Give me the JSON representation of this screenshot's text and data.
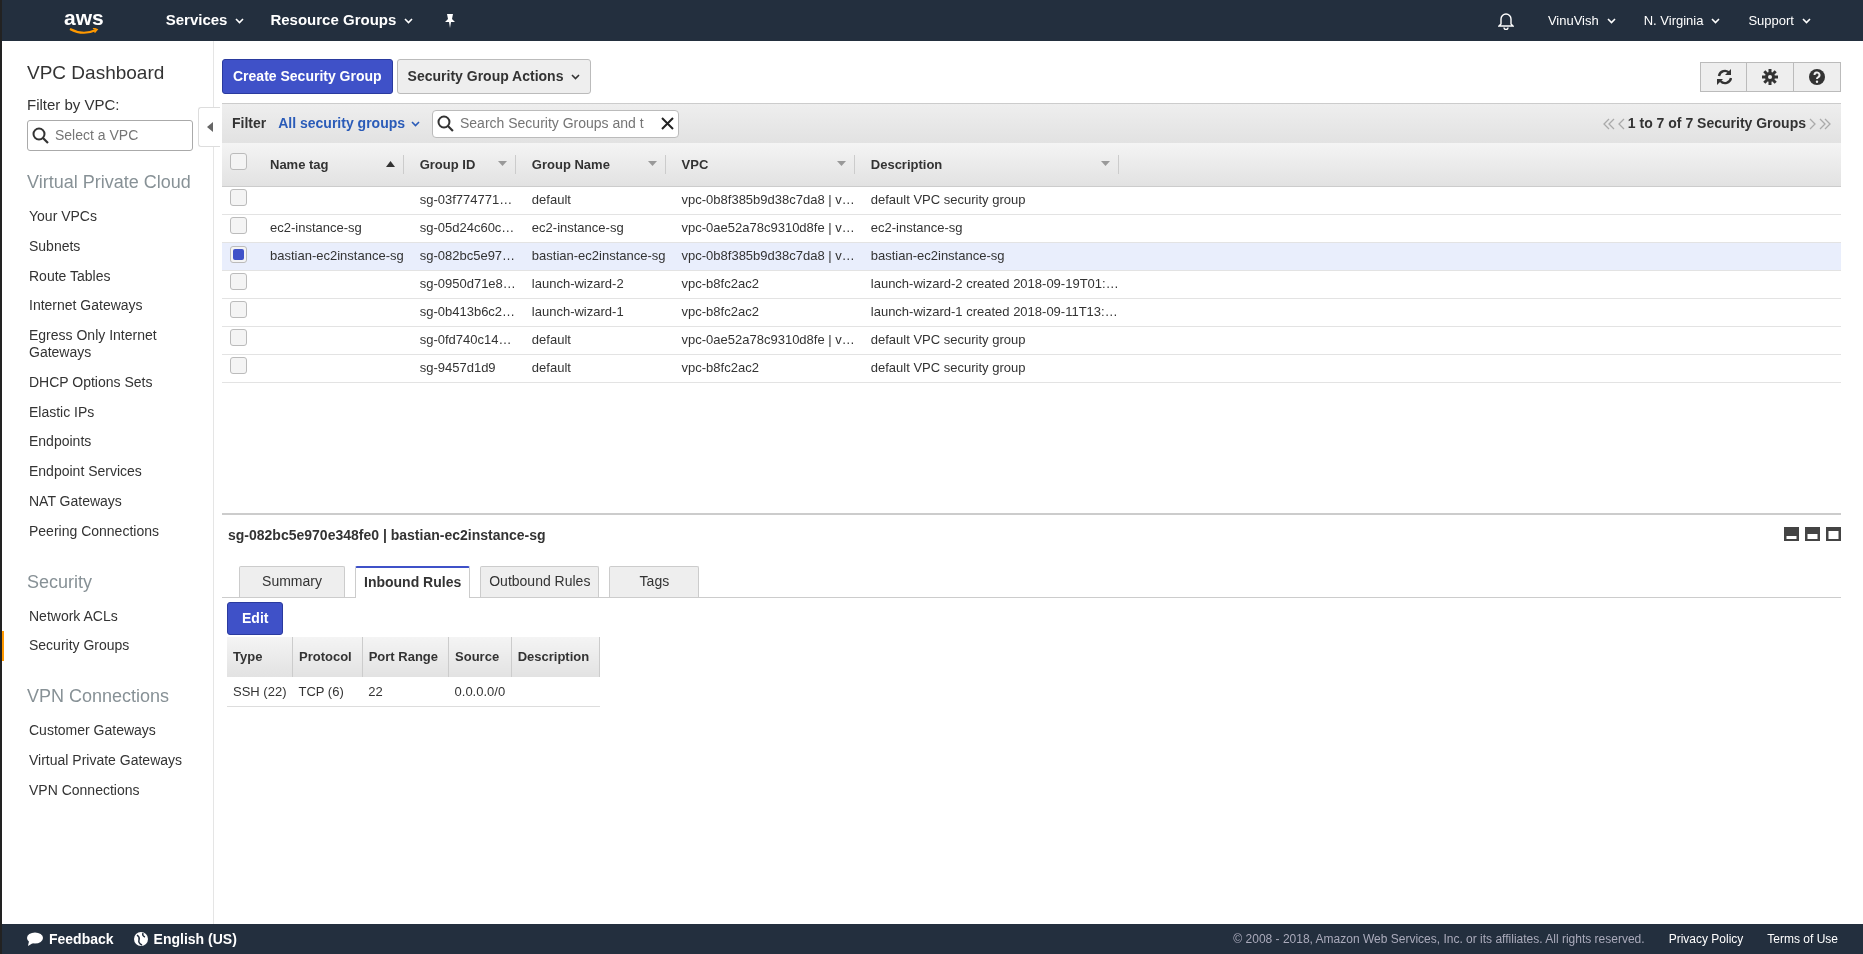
{
  "topbar": {
    "logo": "aws",
    "menus": [
      {
        "label": "Services"
      },
      {
        "label": "Resource Groups"
      }
    ],
    "right_menus": [
      {
        "label": "VinuVish"
      },
      {
        "label": "N. Virginia"
      },
      {
        "label": "Support"
      }
    ]
  },
  "sidebar": {
    "title": "VPC Dashboard",
    "filter_label": "Filter by VPC:",
    "filter_placeholder": "Select a VPC",
    "sections": [
      {
        "heading": "Virtual Private Cloud",
        "items": [
          {
            "label": "Your VPCs",
            "selected": false
          },
          {
            "label": "Subnets",
            "selected": false
          },
          {
            "label": "Route Tables",
            "selected": false
          },
          {
            "label": "Internet Gateways",
            "selected": false
          },
          {
            "label": "Egress Only Internet Gateways",
            "selected": false
          },
          {
            "label": "DHCP Options Sets",
            "selected": false
          },
          {
            "label": "Elastic IPs",
            "selected": false
          },
          {
            "label": "Endpoints",
            "selected": false
          },
          {
            "label": "Endpoint Services",
            "selected": false
          },
          {
            "label": "NAT Gateways",
            "selected": false
          },
          {
            "label": "Peering Connections",
            "selected": false
          }
        ]
      },
      {
        "heading": "Security",
        "items": [
          {
            "label": "Network ACLs",
            "selected": false
          },
          {
            "label": "Security Groups",
            "selected": true
          }
        ]
      },
      {
        "heading": "VPN Connections",
        "items": [
          {
            "label": "Customer Gateways",
            "selected": false
          },
          {
            "label": "Virtual Private Gateways",
            "selected": false
          },
          {
            "label": "VPN Connections",
            "selected": false
          }
        ]
      }
    ]
  },
  "toolbar": {
    "create_button": "Create Security Group",
    "actions_button": "Security Group Actions"
  },
  "filter_bar": {
    "label": "Filter",
    "dropdown": "All security groups",
    "search_placeholder": "Search Security Groups and t",
    "pagination": "1 to 7 of 7 Security Groups"
  },
  "table": {
    "select_all_checked": false,
    "columns": [
      {
        "label": "Name tag",
        "sorted": true
      },
      {
        "label": "Group ID",
        "sorted": false
      },
      {
        "label": "Group Name",
        "sorted": false
      },
      {
        "label": "VPC",
        "sorted": false
      },
      {
        "label": "Description",
        "sorted": false
      }
    ],
    "rows": [
      {
        "selected": false,
        "cells": [
          "",
          "sg-03f774771…",
          "default",
          "vpc-0b8f385b9d38c7da8 | v…",
          "default VPC security group"
        ]
      },
      {
        "selected": false,
        "cells": [
          "ec2-instance-sg",
          "sg-05d24c60c…",
          "ec2-instance-sg",
          "vpc-0ae52a78c9310d8fe | v…",
          "ec2-instance-sg"
        ]
      },
      {
        "selected": true,
        "cells": [
          "bastian-ec2instance-sg",
          "sg-082bc5e97…",
          "bastian-ec2instance-sg",
          "vpc-0b8f385b9d38c7da8 | v…",
          "bastian-ec2instance-sg"
        ]
      },
      {
        "selected": false,
        "cells": [
          "",
          "sg-0950d71e8…",
          "launch-wizard-2",
          "vpc-b8fc2ac2",
          "launch-wizard-2 created 2018-09-19T01:…"
        ]
      },
      {
        "selected": false,
        "cells": [
          "",
          "sg-0b413b6c2…",
          "launch-wizard-1",
          "vpc-b8fc2ac2",
          "launch-wizard-1 created 2018-09-11T13:…"
        ]
      },
      {
        "selected": false,
        "cells": [
          "",
          "sg-0fd740c14…",
          "default",
          "vpc-0ae52a78c9310d8fe | v…",
          "default VPC security group"
        ]
      },
      {
        "selected": false,
        "cells": [
          "",
          "sg-9457d1d9",
          "default",
          "vpc-b8fc2ac2",
          "default VPC security group"
        ]
      }
    ]
  },
  "detail": {
    "title": "sg-082bc5e970e348fe0 | bastian-ec2instance-sg",
    "tabs": [
      {
        "label": "Summary",
        "selected": false
      },
      {
        "label": "Inbound Rules",
        "selected": true
      },
      {
        "label": "Outbound Rules",
        "selected": false
      },
      {
        "label": "Tags",
        "selected": false
      }
    ],
    "edit_button": "Edit",
    "rules": {
      "columns": [
        "Type",
        "Protocol",
        "Port Range",
        "Source",
        "Description"
      ],
      "rows": [
        [
          "SSH (22)",
          "TCP (6)",
          "22",
          "0.0.0.0/0",
          ""
        ]
      ]
    }
  },
  "footer": {
    "feedback": "Feedback",
    "language": "English (US)",
    "copyright": "© 2008 - 2018, Amazon Web Services, Inc. or its affiliates. All rights reserved.",
    "links": [
      "Privacy Policy",
      "Terms of Use"
    ]
  }
}
